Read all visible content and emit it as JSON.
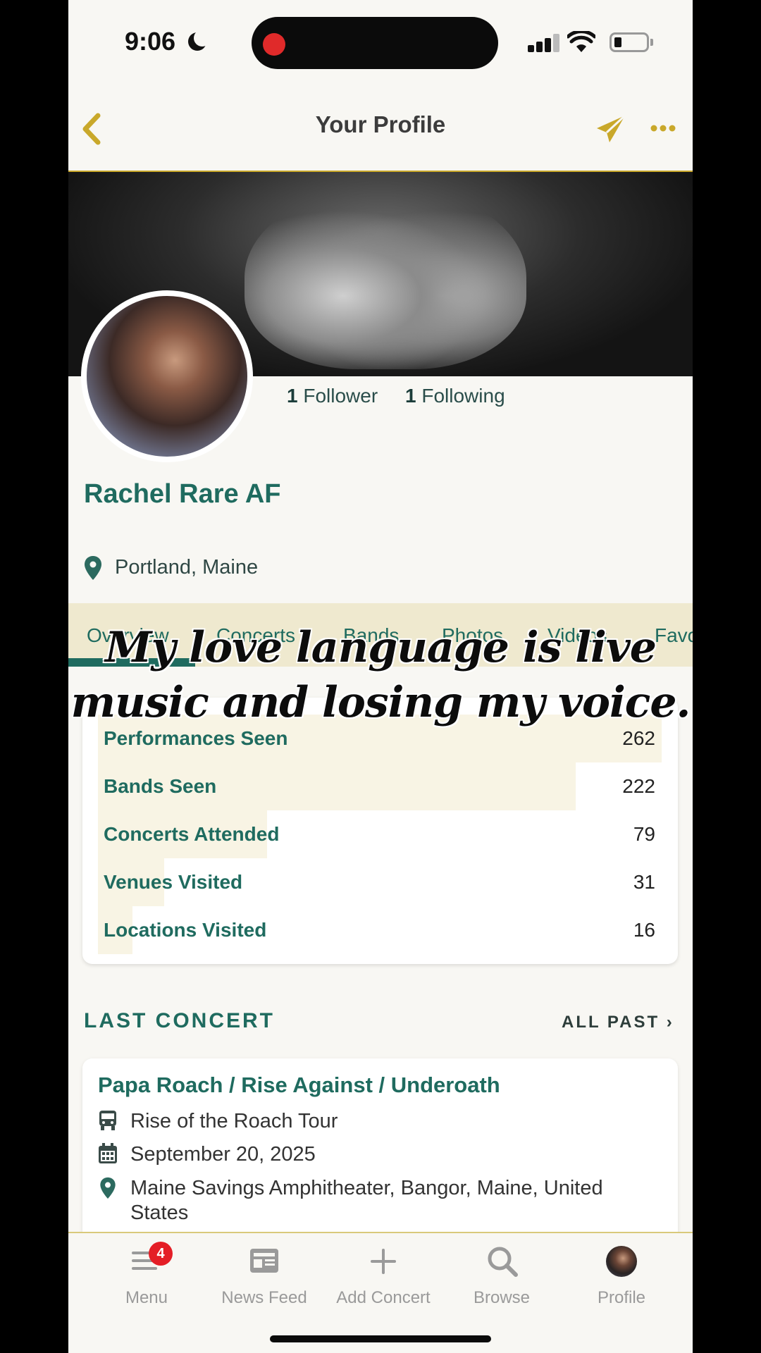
{
  "status_bar": {
    "time": "9:06"
  },
  "header": {
    "title": "Your Profile"
  },
  "profile": {
    "followers_count": "1",
    "followers_label": "Follower",
    "following_count": "1",
    "following_label": "Following",
    "name": "Rachel Rare AF",
    "location": "Portland, Maine"
  },
  "tabs": [
    "Overview",
    "Concerts",
    "Bands",
    "Photos",
    "Videos",
    "Favo"
  ],
  "overlay_caption": {
    "line1": "My love language is live",
    "line2": "music and losing my voice."
  },
  "stats": [
    {
      "label": "Performances Seen",
      "value": "262",
      "fill": 1.0
    },
    {
      "label": "Bands Seen",
      "value": "222",
      "fill": 0.847
    },
    {
      "label": "Concerts Attended",
      "value": "79",
      "fill": 0.3
    },
    {
      "label": "Venues Visited",
      "value": "31",
      "fill": 0.118
    },
    {
      "label": "Locations Visited",
      "value": "16",
      "fill": 0.061
    }
  ],
  "last_concert": {
    "section_title": "LAST CONCERT",
    "all_past": "ALL PAST",
    "title": "Papa Roach / Rise Against / Underoath",
    "tour": "Rise of the Roach Tour",
    "date": "September 20, 2025",
    "venue_line1": "Maine Savings Amphitheater, Bangor, Maine, United",
    "venue_line2": "States"
  },
  "bottom_nav": {
    "menu": "Menu",
    "menu_badge": "4",
    "news_feed": "News Feed",
    "add_concert": "Add Concert",
    "browse": "Browse",
    "profile": "Profile"
  },
  "colors": {
    "accent_green": "#1f6b5f",
    "accent_gold": "#c9a82a",
    "badge_red": "#e41e26"
  }
}
